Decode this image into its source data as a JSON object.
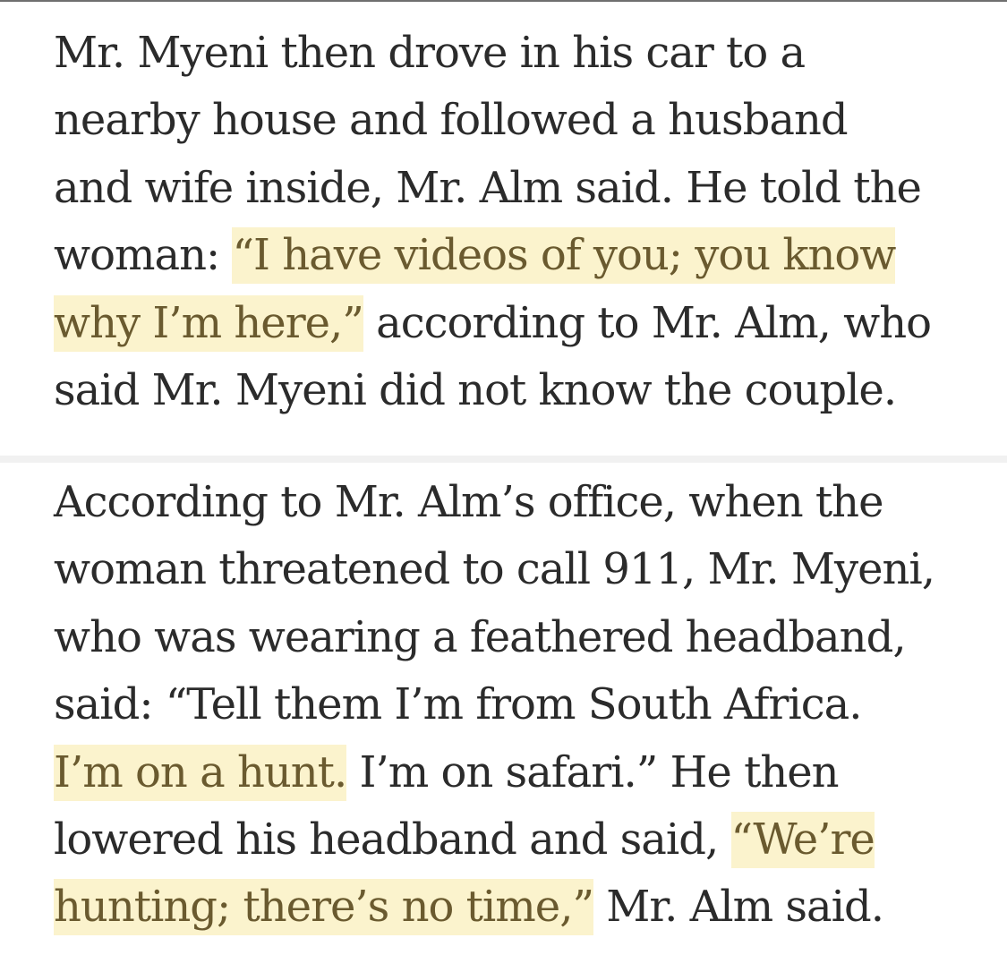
{
  "article": {
    "paragraph_1": {
      "lines": [
        [
          {
            "text": "Mr. Myeni then drove in his car to a"
          }
        ],
        [
          {
            "text": "nearby house and followed a husband"
          }
        ],
        [
          {
            "text": "and wife inside, Mr. Alm said. He told the"
          }
        ],
        [
          {
            "text": "woman: "
          },
          {
            "text": "“I have videos of you; you know",
            "highlight": true
          }
        ],
        [
          {
            "text": "why I’m here,”",
            "highlight": true
          },
          {
            "text": " according to Mr. Alm, who"
          }
        ],
        [
          {
            "text": "said Mr. Myeni did not know the couple."
          }
        ]
      ]
    },
    "paragraph_2": {
      "lines": [
        [
          {
            "text": "According to Mr. Alm’s office, when the"
          }
        ],
        [
          {
            "text": "woman threatened to call 911, Mr. Myeni,"
          }
        ],
        [
          {
            "text": "who was wearing a feathered headband,"
          }
        ],
        [
          {
            "text": "said: “Tell them I’m from South Africa."
          }
        ],
        [
          {
            "text": "I’m on a hunt.",
            "highlight": true
          },
          {
            "text": " I’m on safari.” He then"
          }
        ],
        [
          {
            "text": "lowered his headband and said, "
          },
          {
            "text": "“We’re",
            "highlight": true
          }
        ],
        [
          {
            "text": "hunting; there’s no time,”",
            "highlight": true
          },
          {
            "text": " Mr. Alm said."
          }
        ]
      ]
    }
  },
  "colors": {
    "text": "#2b2b2b",
    "highlight_background": "#fbf3cd",
    "highlight_text": "#6a5a2f",
    "divider": "#f1f1f1"
  }
}
